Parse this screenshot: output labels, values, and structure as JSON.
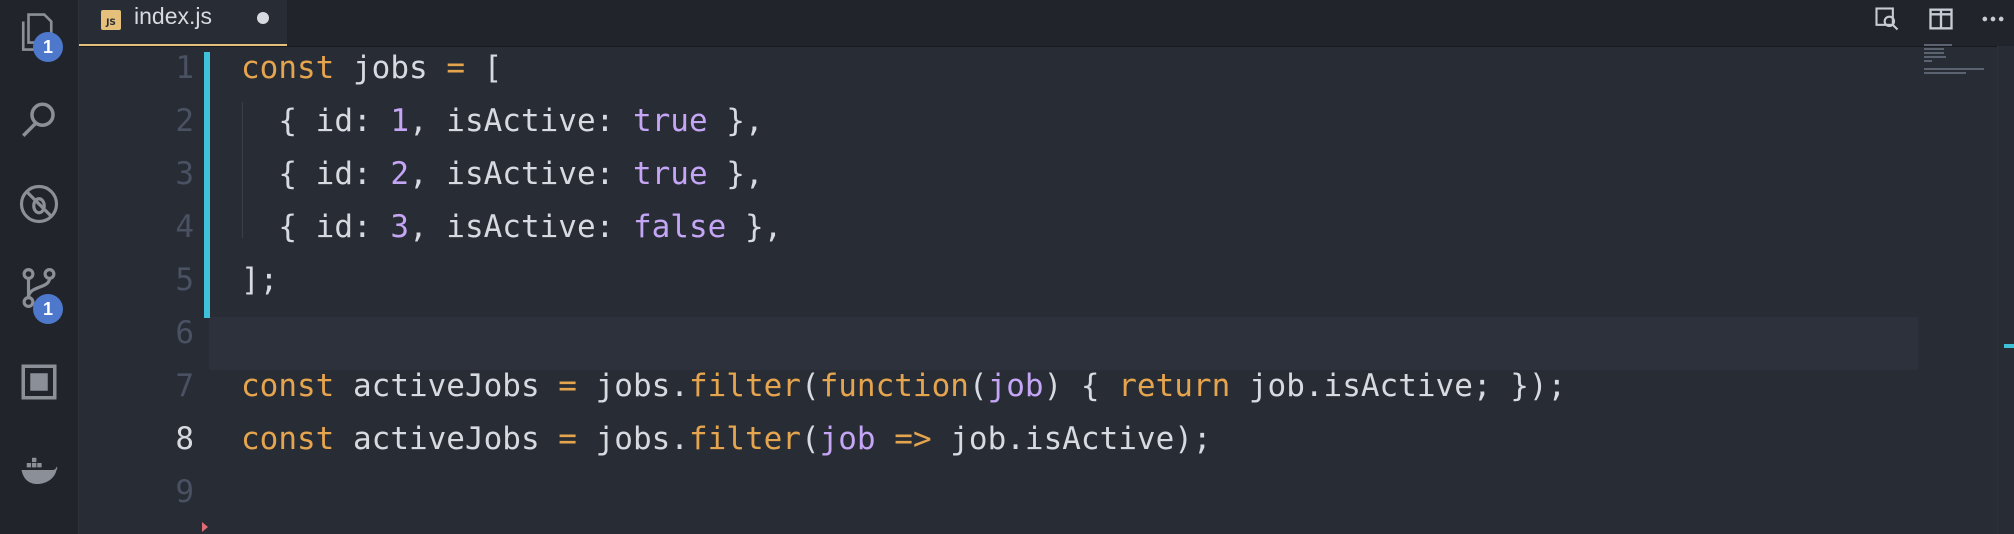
{
  "activity_bar": {
    "explorer_badge": "1",
    "scm_badge": "1",
    "icons": [
      "files-icon",
      "search-icon",
      "debug-icon",
      "source-control-icon",
      "extensions-icon",
      "docker-icon"
    ]
  },
  "tab": {
    "label": "index.js",
    "icon_text": "JS",
    "dirty": true
  },
  "colors": {
    "accent": "#3fc1d9",
    "keyword": "#e5a44e",
    "literal": "#c5a5f5",
    "text": "#d7dae0"
  },
  "code": {
    "lines": [
      {
        "num": "1",
        "text": "const jobs = ["
      },
      {
        "num": "2",
        "text": "  { id: 1, isActive: true },"
      },
      {
        "num": "3",
        "text": "  { id: 2, isActive: true },"
      },
      {
        "num": "4",
        "text": "  { id: 3, isActive: false },"
      },
      {
        "num": "5",
        "text": "];"
      },
      {
        "num": "6",
        "text": ""
      },
      {
        "num": "7",
        "text": "const activeJobs = jobs.filter(function(job) { return job.isActive; });"
      },
      {
        "num": "8",
        "text": "const activeJobs = jobs.filter(job => job.isActive);"
      },
      {
        "num": "9",
        "text": ""
      }
    ],
    "active_line": "8"
  }
}
